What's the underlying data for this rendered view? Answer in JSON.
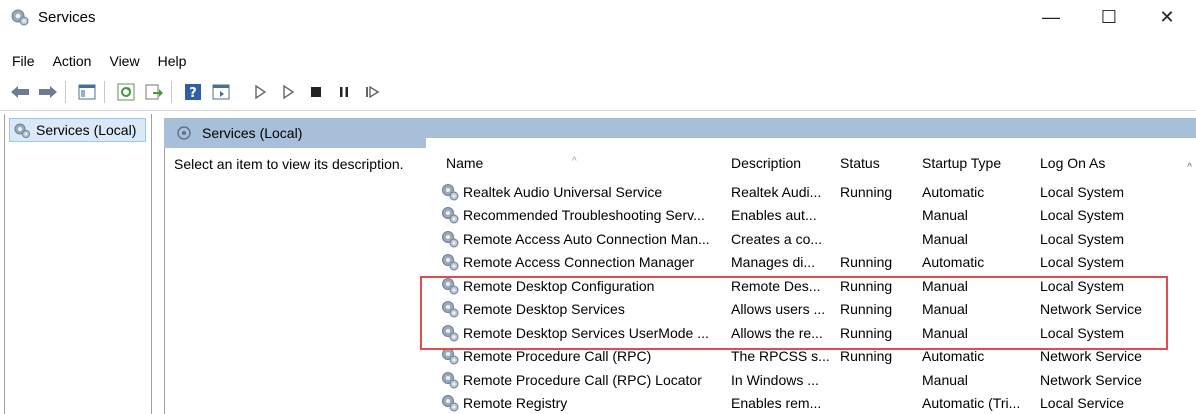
{
  "window": {
    "title": "Services",
    "minimize": "—",
    "maximize": "☐",
    "close": "✕"
  },
  "menu": [
    "File",
    "Action",
    "View",
    "Help"
  ],
  "tree": {
    "item": "Services (Local)"
  },
  "pane": {
    "header": "Services (Local)",
    "description": "Select an item to view its description."
  },
  "columns": {
    "name": "Name",
    "description": "Description",
    "status": "Status",
    "startup": "Startup Type",
    "logon": "Log On As"
  },
  "services": [
    {
      "name": "Realtek Audio Universal Service",
      "description": "Realtek Audi...",
      "status": "Running",
      "startup": "Automatic",
      "logon": "Local System"
    },
    {
      "name": "Recommended Troubleshooting Serv...",
      "description": "Enables aut...",
      "status": "",
      "startup": "Manual",
      "logon": "Local System"
    },
    {
      "name": "Remote Access Auto Connection Man...",
      "description": "Creates a co...",
      "status": "",
      "startup": "Manual",
      "logon": "Local System"
    },
    {
      "name": "Remote Access Connection Manager",
      "description": "Manages di...",
      "status": "Running",
      "startup": "Automatic",
      "logon": "Local System"
    },
    {
      "name": "Remote Desktop Configuration",
      "description": "Remote Des...",
      "status": "Running",
      "startup": "Manual",
      "logon": "Local System"
    },
    {
      "name": "Remote Desktop Services",
      "description": "Allows users ...",
      "status": "Running",
      "startup": "Manual",
      "logon": "Network Service"
    },
    {
      "name": "Remote Desktop Services UserMode ...",
      "description": "Allows the re...",
      "status": "Running",
      "startup": "Manual",
      "logon": "Local System"
    },
    {
      "name": "Remote Procedure Call (RPC)",
      "description": "The RPCSS s...",
      "status": "Running",
      "startup": "Automatic",
      "logon": "Network Service"
    },
    {
      "name": "Remote Procedure Call (RPC) Locator",
      "description": "In Windows ...",
      "status": "",
      "startup": "Manual",
      "logon": "Network Service"
    },
    {
      "name": "Remote Registry",
      "description": "Enables rem...",
      "status": "",
      "startup": "Automatic (Tri...",
      "logon": "Local Service"
    }
  ],
  "colors": {
    "header_bar": "#a8bfd9",
    "tree_selected": "#d9e9f7",
    "highlight": "#e34b4f"
  },
  "icons": [
    "services-gear-icon",
    "back-arrow-icon",
    "forward-arrow-icon",
    "console-tree-icon",
    "refresh-icon",
    "export-list-icon",
    "help-icon",
    "properties-icon",
    "start-service-icon",
    "stop-service-icon",
    "pause-service-icon",
    "resume-service-icon"
  ]
}
